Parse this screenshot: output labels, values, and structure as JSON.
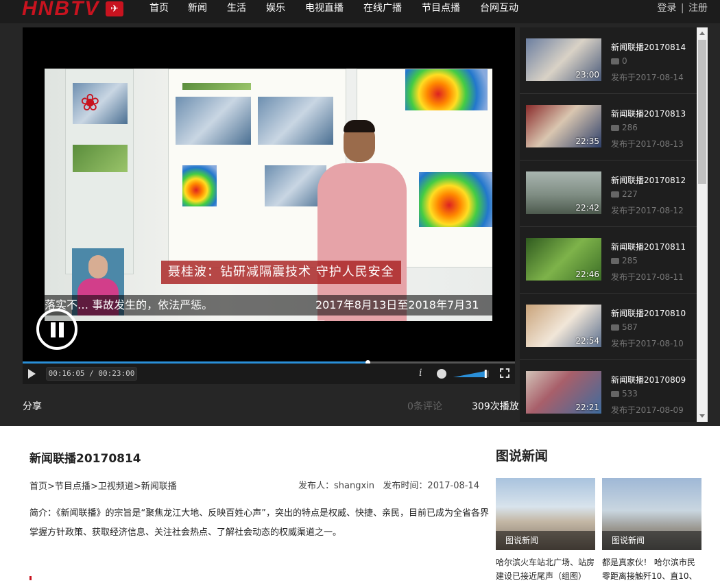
{
  "header": {
    "logo": "HNBTV",
    "nav": [
      "首页",
      "新闻",
      "生活",
      "娱乐",
      "电视直播",
      "在线广播",
      "节目点播",
      "台网互动"
    ],
    "login": "登录",
    "separator": "|",
    "register": "注册"
  },
  "player": {
    "caption_title": "聂桂波：钻研减隔震技术  守护人民安全",
    "subtitle_left": "落实不… 事故发生的，依法严惩。",
    "subtitle_right": "2017年8月13日至2018年7月31日，",
    "time_display": "00:16:05 / 00:23:00",
    "progress_fraction": 0.7,
    "volume_fraction": 0.9,
    "info_icon_label": "i"
  },
  "below_player": {
    "share": "分享",
    "comments": "0条评论",
    "plays": "309次播放"
  },
  "playlist": [
    {
      "title": "新闻联播20170814",
      "plays": "0",
      "date": "发布于2017-08-14",
      "duration": "23:00"
    },
    {
      "title": "新闻联播20170813",
      "plays": "286",
      "date": "发布于2017-08-13",
      "duration": "22:35"
    },
    {
      "title": "新闻联播20170812",
      "plays": "227",
      "date": "发布于2017-08-12",
      "duration": "22:42"
    },
    {
      "title": "新闻联播20170811",
      "plays": "285",
      "date": "发布于2017-08-11",
      "duration": "22:46"
    },
    {
      "title": "新闻联播20170810",
      "plays": "587",
      "date": "发布于2017-08-10",
      "duration": "22:54"
    },
    {
      "title": "新闻联播20170809",
      "plays": "533",
      "date": "发布于2017-08-09",
      "duration": "22:21"
    }
  ],
  "article": {
    "title": "新闻联播20170814",
    "breadcrumb": [
      "首页",
      "节目点播",
      "卫视频道",
      "新闻联播"
    ],
    "breadcrumb_sep": ">",
    "publisher": "发布人：shangxin",
    "publish_time": "发布时间：2017-08-14",
    "description": "简介：《新闻联播》的宗旨是“聚焦龙江大地、反映百姓心声”，突出的特点是权威、快捷、亲民，目前已成为全省各界掌握方针政策、获取经济信息、关注社会热点、了解社会动态的权威渠道之一。"
  },
  "picnews": {
    "heading": "图说新闻",
    "items": [
      {
        "label": "图说新闻",
        "caption": "哈尔滨火车站北广场、站房建设已接近尾声（组图）"
      },
      {
        "label": "图说新闻",
        "caption": "都是真家伙！ 哈尔滨市民零距离接触歼10、直10、"
      }
    ]
  },
  "colors": {
    "brand_red": "#c8131f",
    "progress_blue": "#2a8fd8",
    "dark_bg": "#262626"
  }
}
